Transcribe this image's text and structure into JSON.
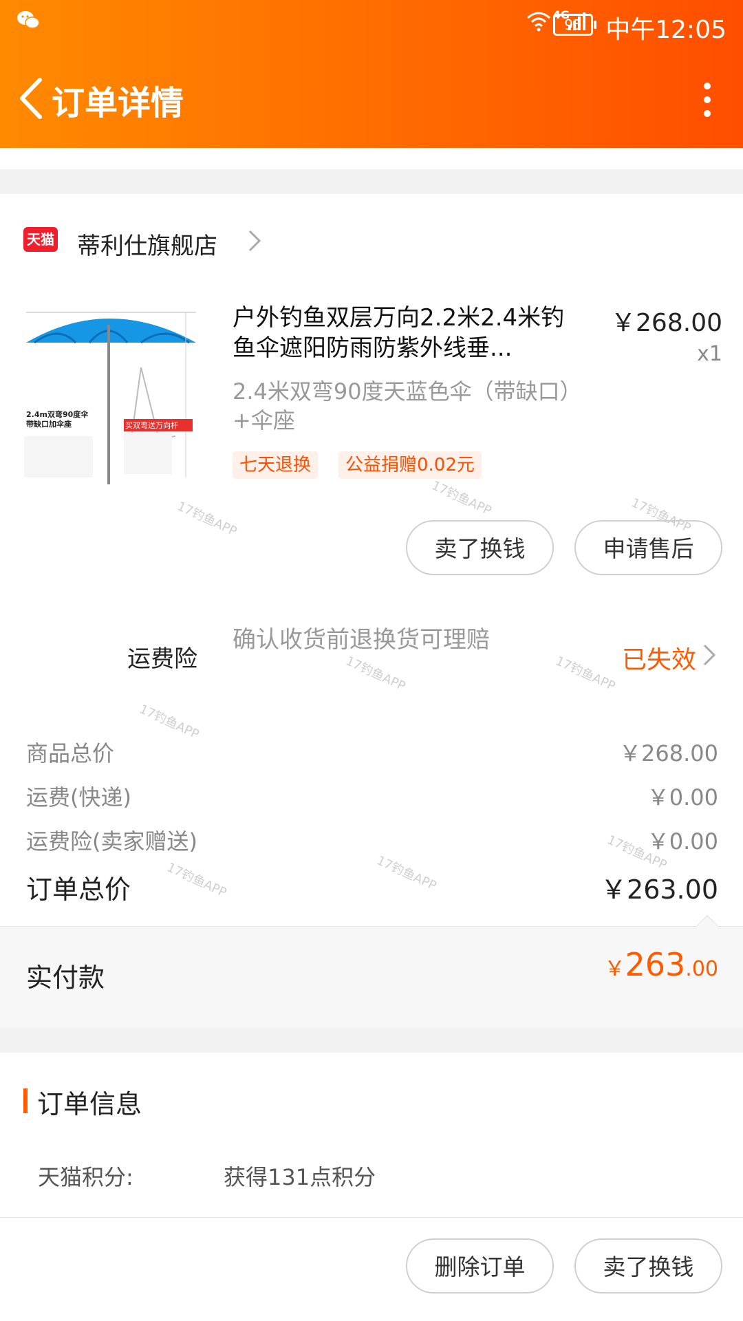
{
  "status_bar": {
    "time": "中午12:05",
    "battery": "95",
    "network": "4G",
    "icons": [
      "wechat-icon",
      "wifi-icon",
      "signal-icon",
      "battery-icon"
    ]
  },
  "header": {
    "title": "订单详情",
    "back_icon": "chevron-left-icon",
    "more_icon": "more-vertical-icon"
  },
  "shop": {
    "badge": "天猫",
    "name": "蒂利仕旗舰店"
  },
  "product": {
    "title": "户外钓鱼双层万向2.2米2.4米钓鱼伞遮阳防雨防紫外线垂...",
    "price": "￥268.00",
    "quantity": "x1",
    "spec": "2.4米双弯90度天蓝色伞（带缺口）+伞座",
    "tags": [
      "七天退换",
      "公益捐赠0.02元"
    ],
    "image_caption": "2.4m双弯90度伞带缺口加伞座",
    "image_badge": "买双弯送万向杆",
    "buttons": [
      "卖了换钱",
      "申请售后"
    ]
  },
  "insurance": {
    "label": "运费险",
    "description": "确认收货前退换货可理赔",
    "status": "已失效"
  },
  "price_rows": [
    {
      "label": "商品总价",
      "value": "￥268.00"
    },
    {
      "label": "运费(快递)",
      "value": "￥0.00"
    },
    {
      "label": "运费险(卖家赠送)",
      "value": "￥0.00"
    }
  ],
  "order_total": {
    "label": "订单总价",
    "value": "￥263.00"
  },
  "paid": {
    "label": "实付款",
    "symbol": "￥",
    "main": "263",
    "decimal": ".00"
  },
  "order_info": {
    "title": "订单信息",
    "points_label": "天猫积分:",
    "points_value": "获得131点积分"
  },
  "footer_buttons": [
    "删除订单",
    "卖了换钱"
  ],
  "watermark": "17钓鱼APP",
  "colors": {
    "accent": "#ff5a00",
    "header_start": "#ff8a00",
    "header_end": "#ff4e00",
    "tmall_red": "#ef1e2d"
  }
}
